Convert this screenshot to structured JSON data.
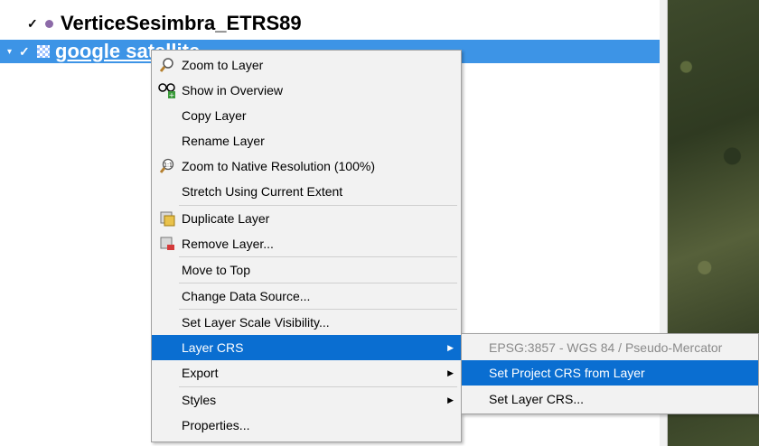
{
  "layers_panel": {
    "layer1": {
      "check": "✓",
      "name": "VerticeSesimbra_ETRS89",
      "icon": "point-layer-icon"
    },
    "layer2": {
      "check": "✓",
      "name": "google satellite",
      "icon": "raster-layer-icon"
    }
  },
  "context_menu": {
    "items": [
      {
        "label": "Zoom to Layer",
        "icon": "zoom-layer-icon"
      },
      {
        "label": "Show in Overview",
        "icon": "overview-icon"
      },
      {
        "label": "Copy Layer"
      },
      {
        "label": "Rename Layer"
      },
      {
        "label": "Zoom to Native Resolution (100%)",
        "icon": "zoom-native-icon"
      },
      {
        "label": "Stretch Using Current Extent"
      },
      {
        "label": "Duplicate Layer",
        "icon": "duplicate-layer-icon"
      },
      {
        "label": "Remove Layer...",
        "icon": "remove-layer-icon"
      },
      {
        "label": "Move to Top"
      },
      {
        "label": "Change Data Source..."
      },
      {
        "label": "Set Layer Scale Visibility..."
      },
      {
        "label": "Layer CRS",
        "selected": true,
        "submenu": true
      },
      {
        "label": "Export",
        "submenu": true
      },
      {
        "label": "Styles",
        "submenu": true
      },
      {
        "label": "Properties..."
      }
    ]
  },
  "crs_submenu": {
    "items": [
      {
        "label": "EPSG:3857 - WGS 84 / Pseudo-Mercator",
        "disabled": true
      },
      {
        "label": "Set Project CRS from Layer",
        "selected": true
      },
      {
        "label": "Set Layer CRS..."
      }
    ]
  },
  "colors": {
    "selection": "#0a6ed1",
    "tree_selection": "#3d94e6"
  }
}
